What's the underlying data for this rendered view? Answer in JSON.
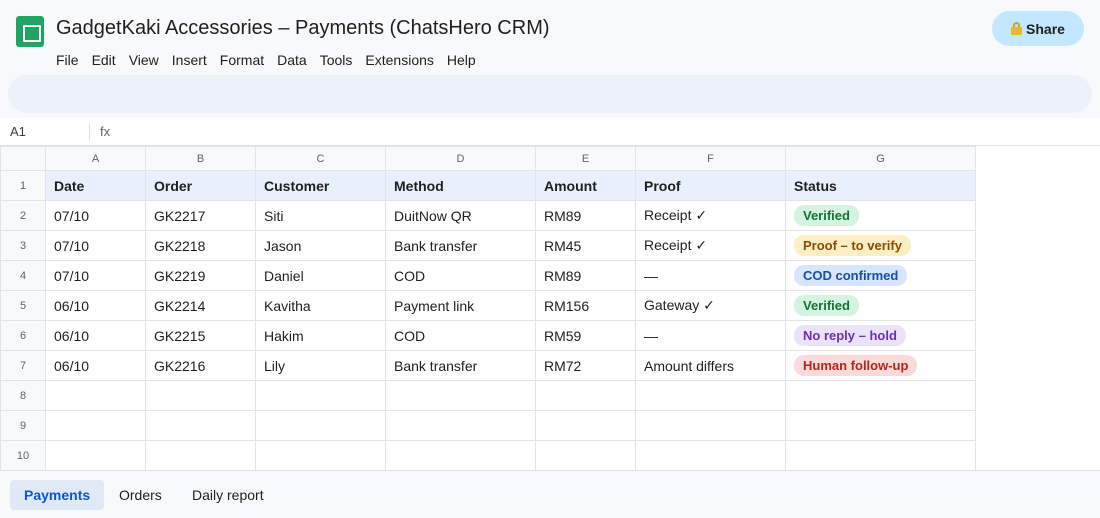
{
  "document": {
    "title": "GadgetKaki Accessories – Payments (ChatsHero CRM)"
  },
  "menu": [
    "File",
    "Edit",
    "View",
    "Insert",
    "Format",
    "Data",
    "Tools",
    "Extensions",
    "Help"
  ],
  "share": {
    "label": "Share",
    "icon": "lock-icon"
  },
  "formula_bar": {
    "cell_ref": "A1",
    "fx": "fx",
    "value": ""
  },
  "columns": [
    "A",
    "B",
    "C",
    "D",
    "E",
    "F",
    "G"
  ],
  "row_numbers": [
    "1",
    "2",
    "3",
    "4",
    "5",
    "6",
    "7",
    "8",
    "9",
    "10"
  ],
  "header": [
    "Date",
    "Order",
    "Customer",
    "Method",
    "Amount",
    "Proof",
    "Status"
  ],
  "rows": [
    {
      "date": "07/10",
      "order": "GK2217",
      "customer": "Siti",
      "method": "DuitNow QR",
      "amount": "RM89",
      "proof": "Receipt ✓",
      "status": "Verified",
      "status_kind": "verified"
    },
    {
      "date": "07/10",
      "order": "GK2218",
      "customer": "Jason",
      "method": "Bank transfer",
      "amount": "RM45",
      "proof": "Receipt ✓",
      "status": "Proof – to verify",
      "status_kind": "proof"
    },
    {
      "date": "07/10",
      "order": "GK2219",
      "customer": "Daniel",
      "method": "COD",
      "amount": "RM89",
      "proof": "—",
      "status": "COD confirmed",
      "status_kind": "cod"
    },
    {
      "date": "06/10",
      "order": "GK2214",
      "customer": "Kavitha",
      "method": "Payment link",
      "amount": "RM156",
      "proof": "Gateway ✓",
      "status": "Verified",
      "status_kind": "verified"
    },
    {
      "date": "06/10",
      "order": "GK2215",
      "customer": "Hakim",
      "method": "COD",
      "amount": "RM59",
      "proof": "—",
      "status": "No reply – hold",
      "status_kind": "noreply"
    },
    {
      "date": "06/10",
      "order": "GK2216",
      "customer": "Lily",
      "method": "Bank transfer",
      "amount": "RM72",
      "proof": "Amount differs",
      "status": "Human follow-up",
      "status_kind": "human"
    }
  ],
  "sheet_tabs": [
    {
      "label": "Payments",
      "active": true
    },
    {
      "label": "Orders",
      "active": false
    },
    {
      "label": "Daily report",
      "active": false
    }
  ],
  "colors": {
    "brand": "#1fa463",
    "share_bg": "#c2e7ff",
    "verified": "#137333",
    "proof": "#8a4b00",
    "cod": "#174ea6",
    "noreply": "#6a2fb8",
    "human": "#b3261e"
  }
}
